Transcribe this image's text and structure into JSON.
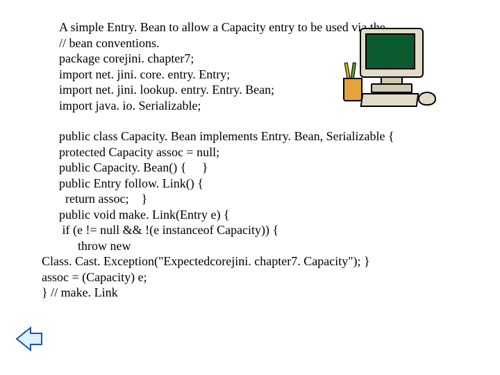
{
  "block1": {
    "l1": "A simple Entry. Bean to allow a Capacity entry to be used via the",
    "l2": "// bean conventions.",
    "l3": "package corejini. chapter7;",
    "l4": "import net. jini. core. entry. Entry;",
    "l5": "import net. jini. lookup. entry. Entry. Bean;",
    "l6": "import java. io. Serializable;"
  },
  "block2": {
    "l1": "public class Capacity. Bean implements Entry. Bean, Serializable {",
    "l2": "protected Capacity assoc = null;",
    "l3": "public Capacity. Bean() {     }",
    "l4": "public Entry follow. Link() {",
    "l5": "  return assoc;    }",
    "l6": "public void make. Link(Entry e) {",
    "l7": " if (e != null && !(e instanceof Capacity)) {",
    "l8": "      throw new",
    "l9": "Class. Cast. Exception(\"Expectedcorejini. chapter7. Capacity\"); }",
    "l10": "assoc = (Capacity) e;",
    "l11": "} // make. Link"
  },
  "nav": {
    "prev": "previous"
  },
  "icons": {
    "computer": "computer-clipart"
  }
}
